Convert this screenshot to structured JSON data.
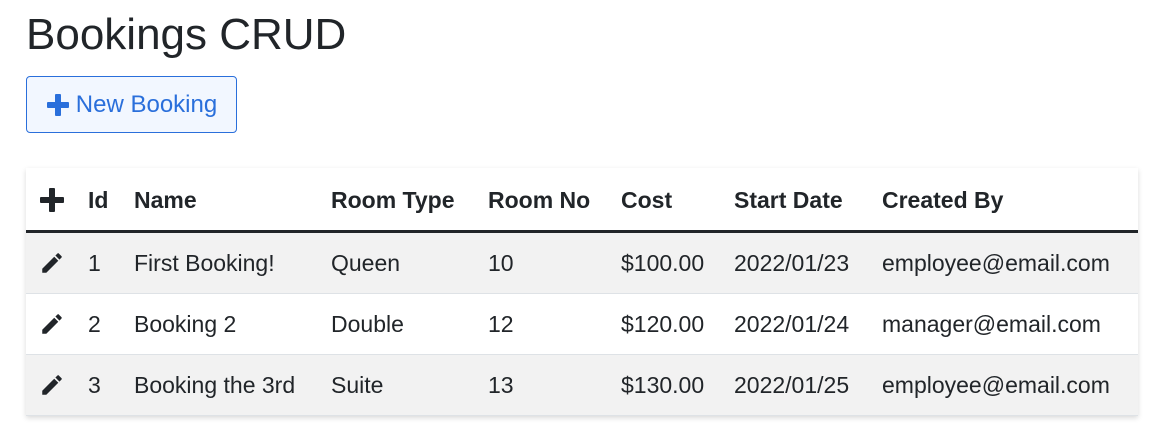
{
  "page": {
    "title": "Bookings CRUD"
  },
  "toolbar": {
    "new_booking_label": "New Booking",
    "new_booking_icon": "plus-icon"
  },
  "colors": {
    "accent": "#2a6fdb",
    "text": "#212529",
    "row_stripe": "#f2f2f2"
  },
  "table": {
    "add_icon": "plus-icon",
    "row_icon": "pencil-icon",
    "headers": {
      "id": "Id",
      "name": "Name",
      "room_type": "Room Type",
      "room_no": "Room No",
      "cost": "Cost",
      "start_date": "Start Date",
      "created_by": "Created By"
    },
    "rows": [
      {
        "id": "1",
        "name": "First Booking!",
        "room_type": "Queen",
        "room_no": "10",
        "cost": "$100.00",
        "start_date": "2022/01/23",
        "created_by": "employee@email.com"
      },
      {
        "id": "2",
        "name": "Booking 2",
        "room_type": "Double",
        "room_no": "12",
        "cost": "$120.00",
        "start_date": "2022/01/24",
        "created_by": "manager@email.com"
      },
      {
        "id": "3",
        "name": "Booking the 3rd",
        "room_type": "Suite",
        "room_no": "13",
        "cost": "$130.00",
        "start_date": "2022/01/25",
        "created_by": "employee@email.com"
      }
    ]
  }
}
